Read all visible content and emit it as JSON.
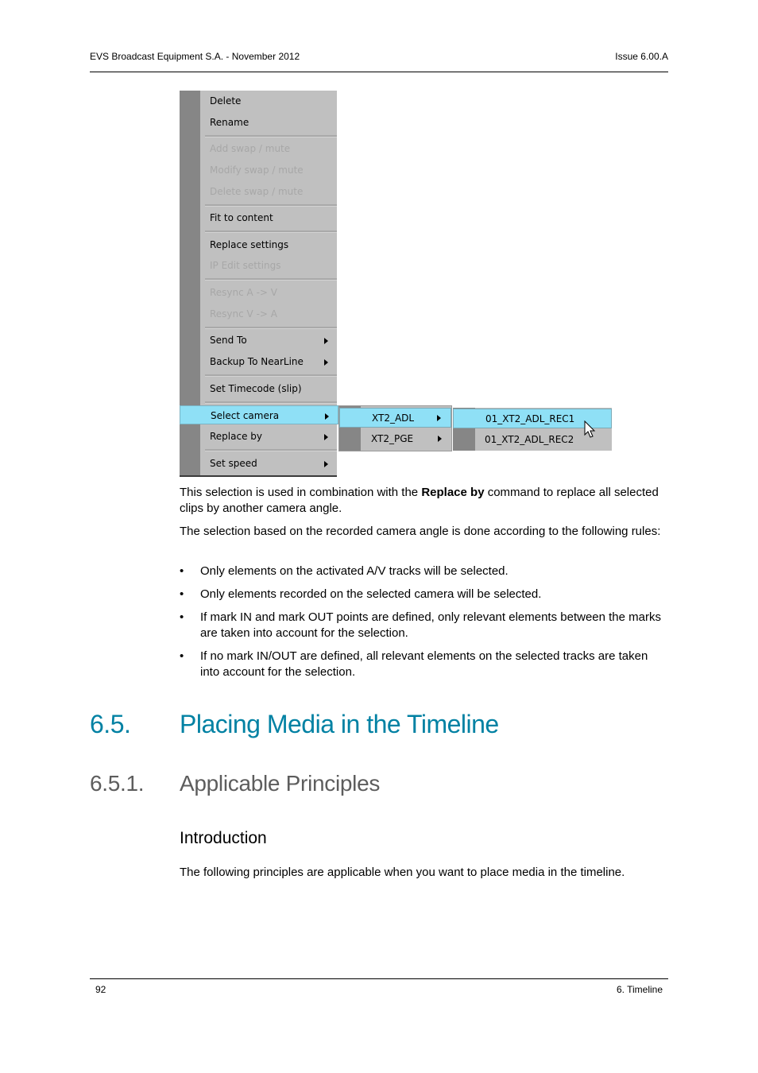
{
  "header": {
    "left": "EVS Broadcast Equipment S.A.  - November 2012",
    "right": "Issue 6.00.A"
  },
  "context_menu": {
    "items": [
      {
        "label": "Delete",
        "disabled": false,
        "submenu": false
      },
      {
        "label": "Rename",
        "disabled": false,
        "submenu": false
      },
      {
        "label": "Add swap / mute",
        "disabled": true,
        "submenu": false
      },
      {
        "label": "Modify swap / mute",
        "disabled": true,
        "submenu": false
      },
      {
        "label": "Delete swap / mute",
        "disabled": true,
        "submenu": false
      },
      {
        "label": "Fit to content",
        "disabled": false,
        "submenu": false
      },
      {
        "label": "Replace settings",
        "disabled": false,
        "submenu": false
      },
      {
        "label": "IP Edit settings",
        "disabled": true,
        "submenu": false
      },
      {
        "label": "Resync A -> V",
        "disabled": true,
        "submenu": false
      },
      {
        "label": "Resync V -> A",
        "disabled": true,
        "submenu": false
      },
      {
        "label": "Send To",
        "disabled": false,
        "submenu": true
      },
      {
        "label": "Backup To NearLine",
        "disabled": false,
        "submenu": true
      },
      {
        "label": "Set Timecode (slip)",
        "disabled": false,
        "submenu": false
      },
      {
        "label": "Select camera",
        "disabled": false,
        "submenu": true,
        "selected": true
      },
      {
        "label": "Replace by",
        "disabled": false,
        "submenu": true
      },
      {
        "label": "Set speed",
        "disabled": false,
        "submenu": true
      }
    ],
    "submenu_servers": [
      {
        "label": "XT2_ADL",
        "selected": true
      },
      {
        "label": "XT2_PGE",
        "selected": false
      }
    ],
    "submenu_cameras": [
      {
        "label": "01_XT2_ADL_REC1",
        "selected": true
      },
      {
        "label": "01_XT2_ADL_REC2",
        "selected": false
      }
    ],
    "highlight_color": "#8fe0f6"
  },
  "body": {
    "para1_before": "This selection is used in combination with the ",
    "para1_bold": "Replace by",
    "para1_after": " command to replace all selected clips by another camera angle.",
    "para2": "The selection based on the recorded camera angle is done according to the following rules:",
    "bullets": [
      "Only elements on the activated A/V tracks will be selected.",
      "Only elements recorded on the selected camera will be selected.",
      "If mark IN and mark OUT points are defined, only relevant elements between the marks are taken into account for the selection.",
      "If no mark IN/OUT are defined, all relevant elements on the selected tracks are taken into account for the selection."
    ],
    "bullet_char": "•"
  },
  "section": {
    "number": "6.5.",
    "title": "Placing Media in the Timeline",
    "color": "#0081a3"
  },
  "subsection": {
    "number": "6.5.1.",
    "title": "Applicable Principles"
  },
  "intro": {
    "heading": "Introduction",
    "text": "The following principles are applicable when you want to place media in the timeline."
  },
  "footer": {
    "page": "92",
    "chapter": "6. Timeline"
  }
}
